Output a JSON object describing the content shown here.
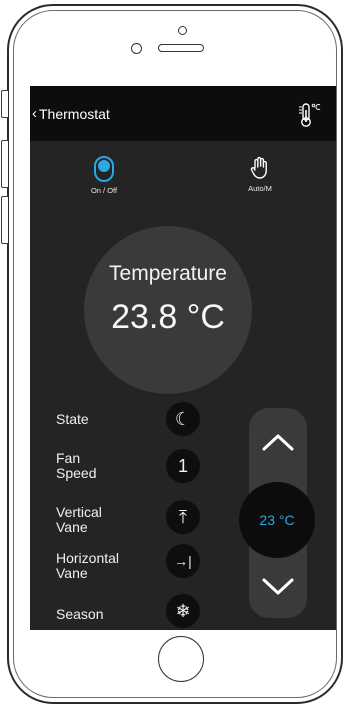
{
  "header": {
    "back_chevron": "‹",
    "title": "Thermostat",
    "thermo_icon": "thermometer-celsius-icon"
  },
  "controls": {
    "power_label": "On / Off",
    "power_state": "on",
    "mode_label": "Auto/M",
    "mode_icon": "hand-icon"
  },
  "temperature": {
    "title": "Temperature",
    "value": "23.8 °C"
  },
  "settings": [
    {
      "label": "State",
      "icon": "moon-icon",
      "glyph": "☾"
    },
    {
      "label": "Fan\nSpeed",
      "icon": "fan-speed-1-icon",
      "glyph": "1"
    },
    {
      "label": "Vertical\nVane",
      "icon": "vertical-vane-icon",
      "glyph": "⤒"
    },
    {
      "label": "Horizontal\nVane",
      "icon": "horizontal-vane-icon",
      "glyph": "→|"
    },
    {
      "label": "Season",
      "icon": "snowflake-icon",
      "glyph": "❄"
    }
  ],
  "setpoint": {
    "value": "23 °C",
    "up_icon": "chevron-up-icon",
    "down_icon": "chevron-down-icon"
  },
  "colors": {
    "accent": "#2ba7e6",
    "screen_bg": "#242424",
    "header_bg": "#0d0d0d",
    "circle_bg": "#3a3a3a"
  }
}
